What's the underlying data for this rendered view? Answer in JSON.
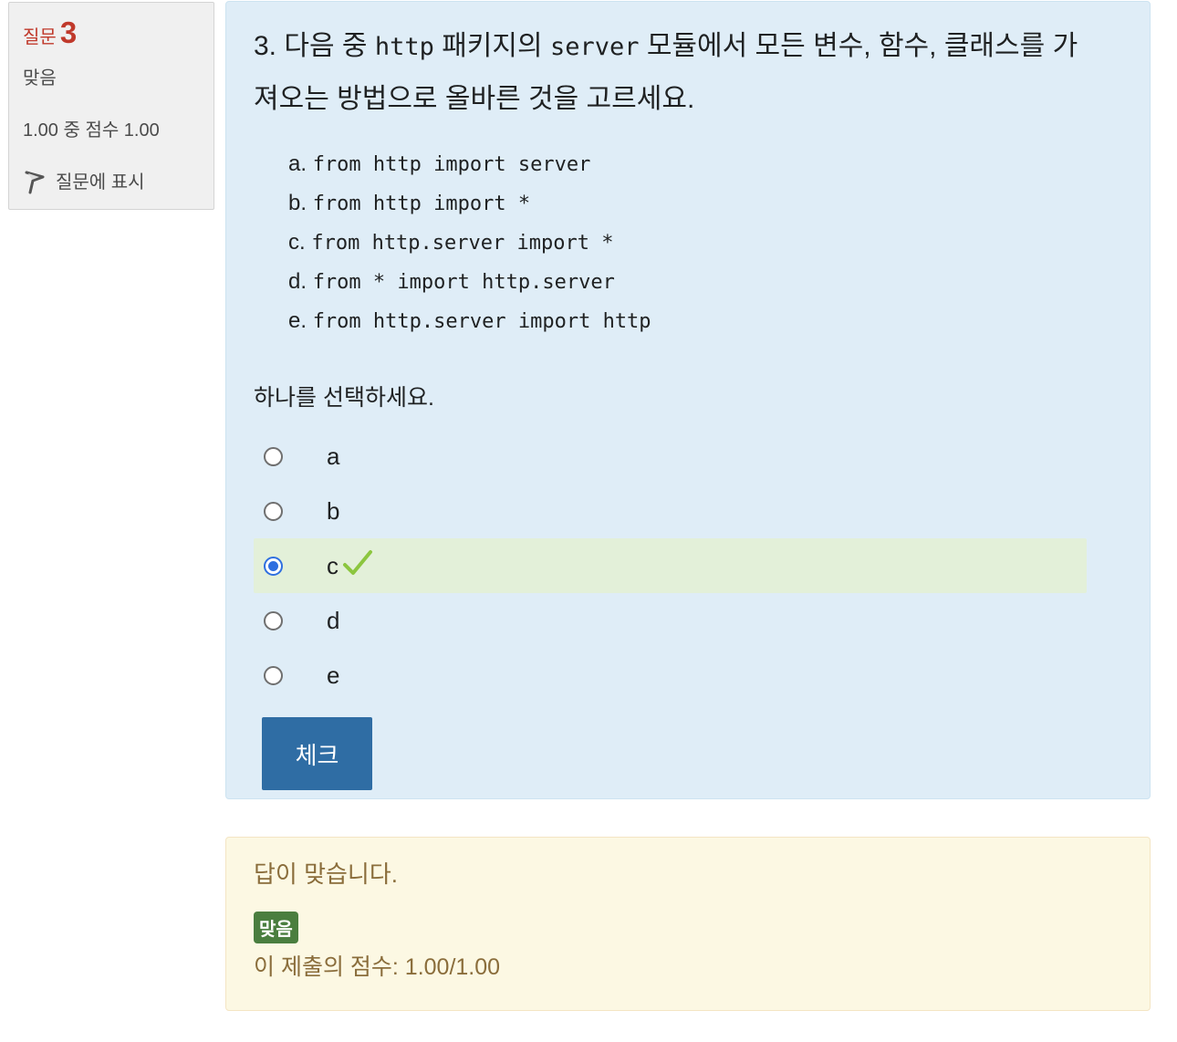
{
  "info": {
    "question_label": "질문",
    "question_number": "3",
    "state": "맞음",
    "grade": "1.00 중 점수 1.00",
    "flag_label": "질문에 표시"
  },
  "question": {
    "text_prefix": "3. 다음 중 ",
    "text_code1": "http",
    "text_mid": " 패키지의 ",
    "text_code2": "server",
    "text_suffix": " 모듈에서 모든 변수, 함수, 클래스를 가져오는 방법으로 올바른 것을 고르세요.",
    "choices": [
      {
        "letter": "a.",
        "code": "from http import server"
      },
      {
        "letter": "b.",
        "code": "from http import *"
      },
      {
        "letter": "c.",
        "code": "from http.server import *"
      },
      {
        "letter": "d.",
        "code": "from * import http.server"
      },
      {
        "letter": "e.",
        "code": "from http.server import http"
      }
    ],
    "prompt": "하나를 선택하세요.",
    "answers": [
      {
        "label": "a",
        "selected": false
      },
      {
        "label": "b",
        "selected": false
      },
      {
        "label": "c",
        "selected": true
      },
      {
        "label": "d",
        "selected": false
      },
      {
        "label": "e",
        "selected": false
      }
    ],
    "check_button": "체크"
  },
  "feedback": {
    "message": "답이 맞습니다.",
    "badge": "맞음",
    "score": "이 제출의 점수: 1.00/1.00"
  },
  "colors": {
    "question_bg": "#dfedf7",
    "correct_row_bg": "#e3f0d9",
    "feedback_bg": "#fcf8e3",
    "button_bg": "#2f6da4",
    "badge_bg": "#4a7e3f",
    "accent_red": "#c0392b"
  },
  "icons": {
    "flag": "flag-icon",
    "correct": "check-icon"
  }
}
